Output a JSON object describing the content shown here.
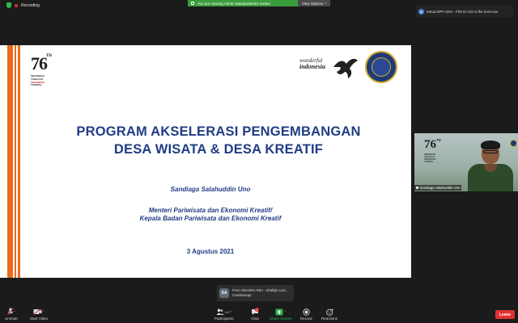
{
  "top": {
    "recording_label": "Recording",
    "share_banner_text": "You are viewing Adrian Manparakrat's screen",
    "view_options_label": "View Options"
  },
  "notification": {
    "text": "Ketua DPP ADKI - Fikri El Aziz is the host now"
  },
  "slide": {
    "logo": {
      "number": "76",
      "superscript": "TH",
      "lines": [
        "INDONESIA",
        "TANGGUH",
        "INDONESIA",
        "TUMBUH"
      ]
    },
    "brand_top": "wonderful",
    "brand_bottom": "indonesia",
    "title_line1": "PROGRAM AKSELERASI PENGEMBANGAN",
    "title_line2": "DESA WISATA & DESA KREATIF",
    "speaker": "Sandiaga Salahuddin Uno",
    "role_line1": "Menteri Pariwisata dan Ekonomi Kreatif/",
    "role_line2": "Kepala Badan Pariwisata dan Ekonomi Kreatif",
    "date": "3 Agustus 2021"
  },
  "video": {
    "participant_name": "Sandiaga Salahuddin Uno"
  },
  "chat_toast": {
    "avatar_initials": "SA",
    "from": "From SEKJEN ADKI - Shafigh Lord...",
    "message": "Coekkesepp"
  },
  "toolbar": {
    "unmute": "Unmute",
    "start_video": "Start Video",
    "participants": "Participants",
    "participants_count": "147",
    "chat": "Chat",
    "chat_badge": "1",
    "share_screen": "Share Screen",
    "record": "Record",
    "reactions": "Reactions",
    "leave": "Leave"
  },
  "colors": {
    "slide_title": "#203d85",
    "stripe": "#ec6a1f",
    "share_banner": "#3a9d3b",
    "leave": "#e0312f"
  }
}
